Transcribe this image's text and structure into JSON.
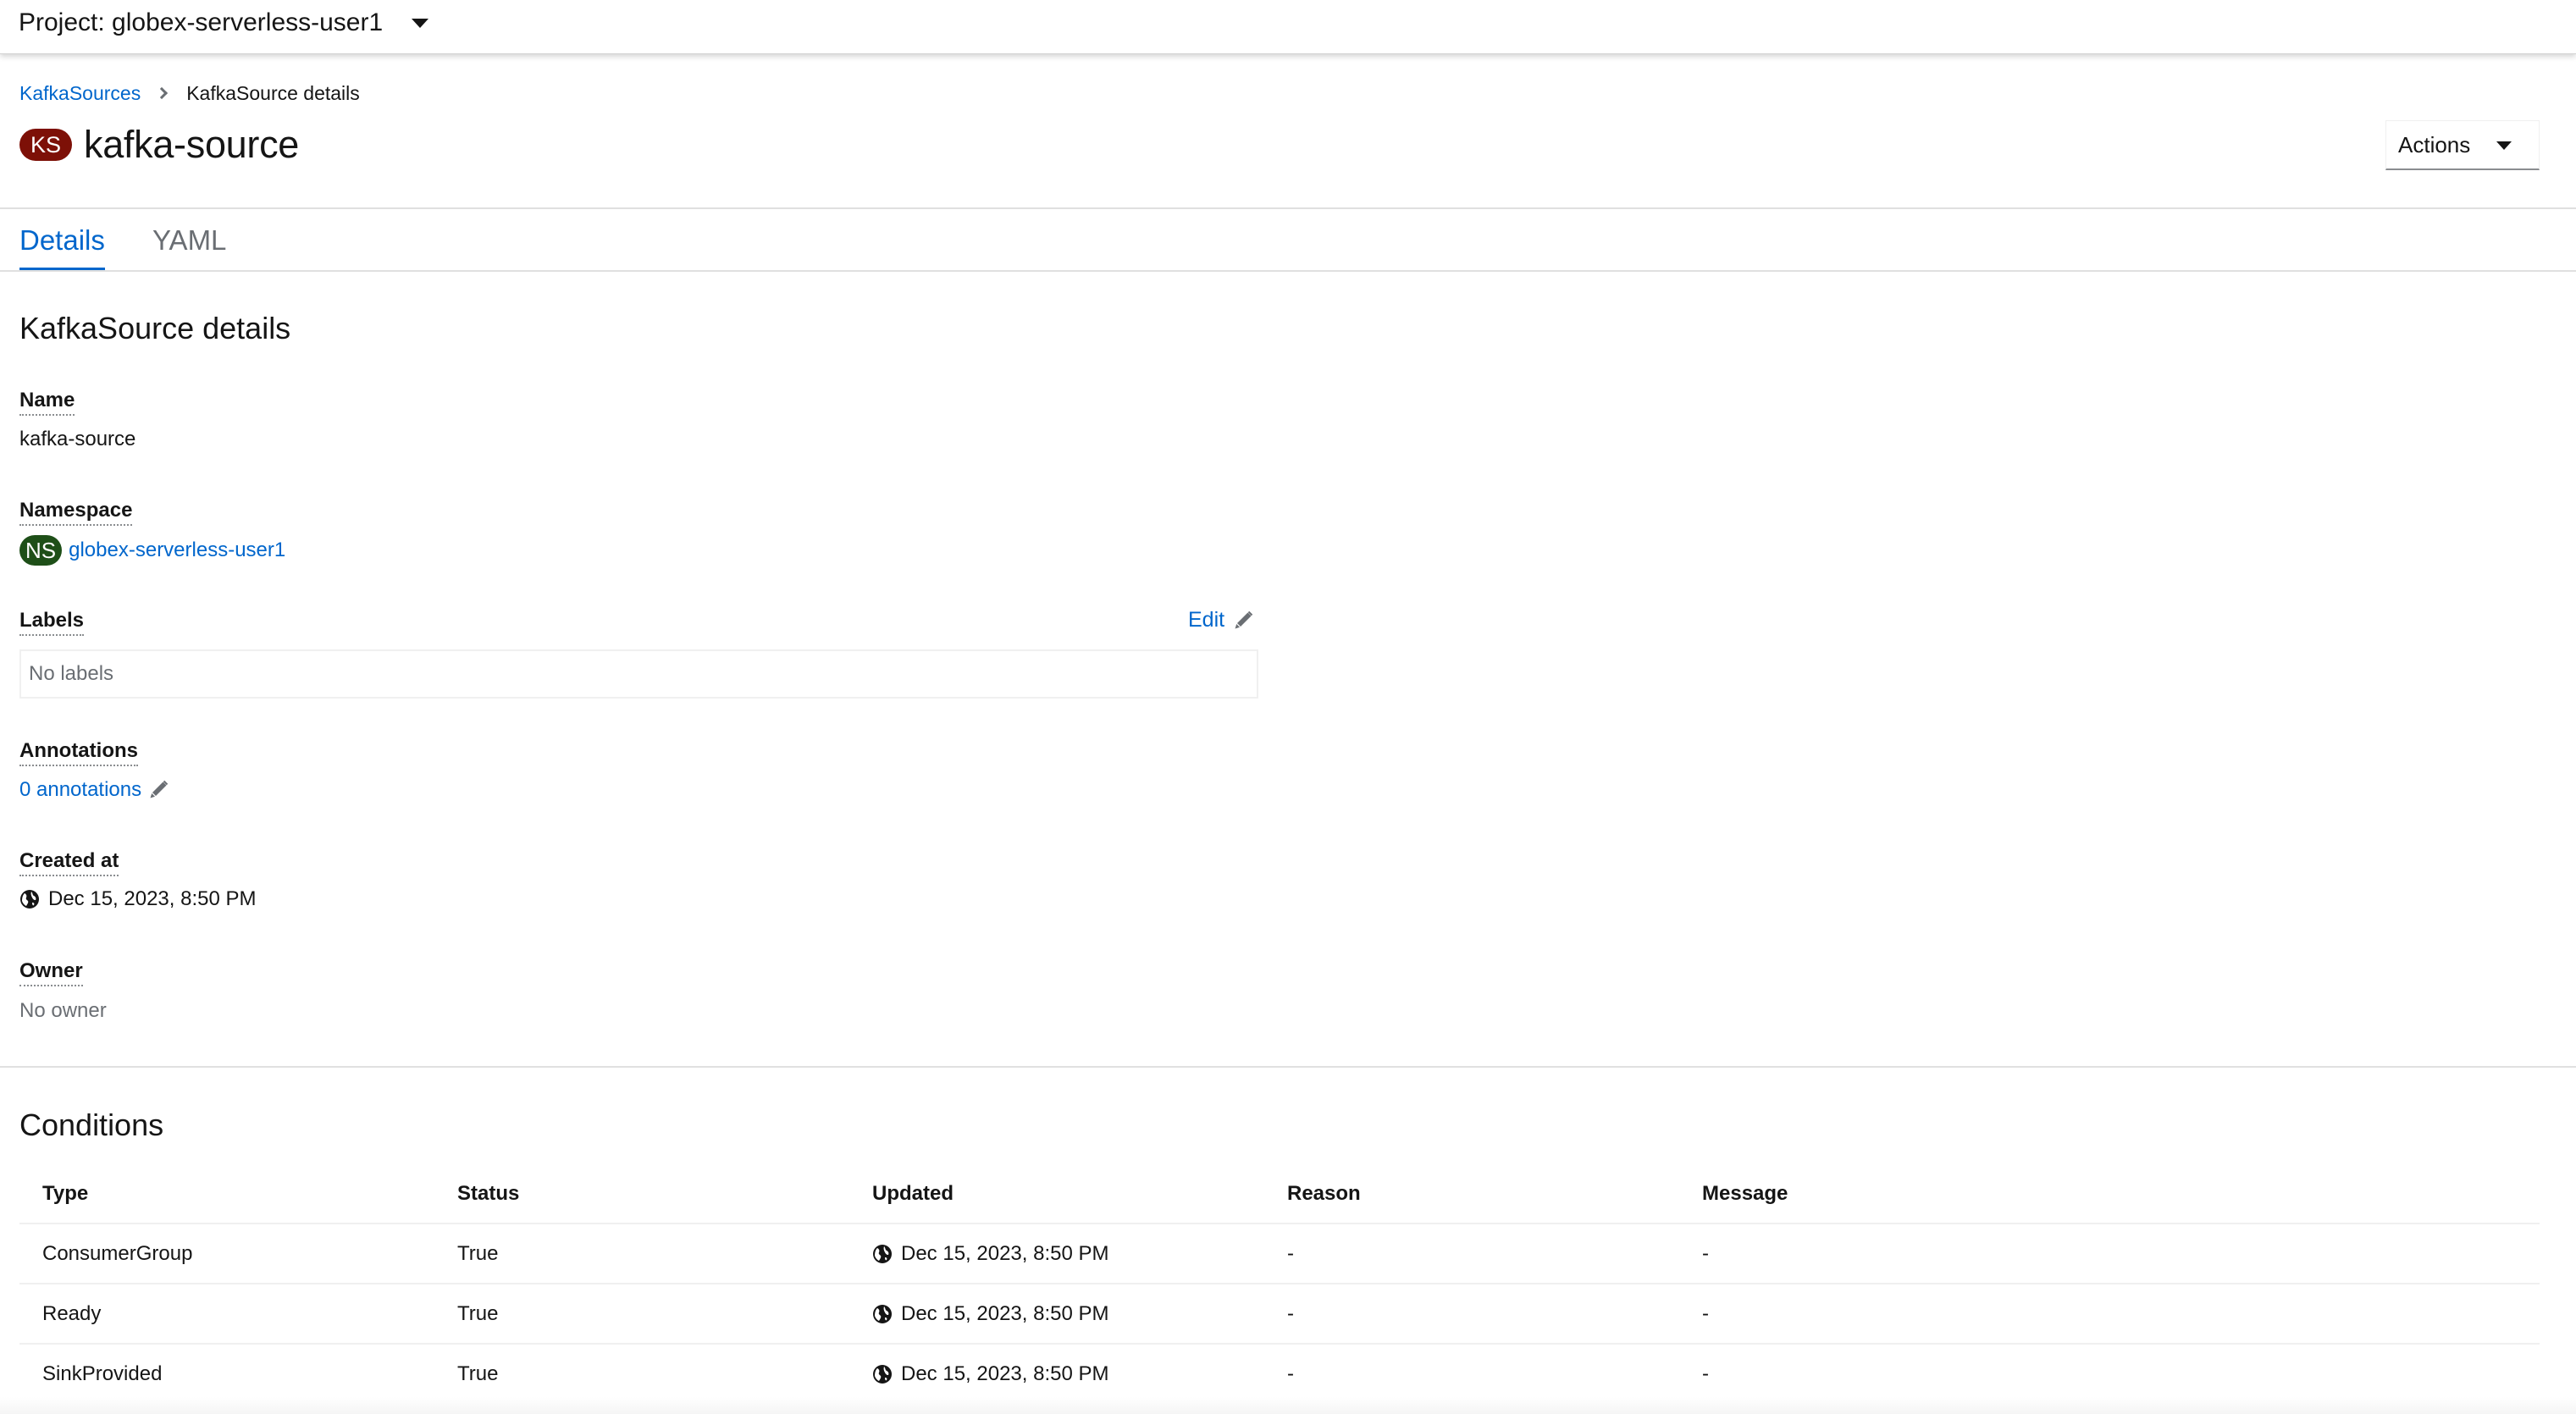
{
  "masthead": {
    "project_label": "Project: globex-serverless-user1"
  },
  "breadcrumb": {
    "parent": "KafkaSources",
    "current": "KafkaSource details"
  },
  "header": {
    "badge_text": "KS",
    "badge_color": "#7d1007",
    "title": "kafka-source",
    "actions_label": "Actions"
  },
  "tabs": [
    {
      "label": "Details",
      "active": true
    },
    {
      "label": "YAML",
      "active": false
    }
  ],
  "details": {
    "heading": "KafkaSource details",
    "name_label": "Name",
    "name_value": "kafka-source",
    "namespace_label": "Namespace",
    "namespace_badge": "NS",
    "namespace_badge_color": "#1e4f18",
    "namespace_value": "globex-serverless-user1",
    "labels_label": "Labels",
    "labels_edit": "Edit",
    "labels_value": "No labels",
    "annotations_label": "Annotations",
    "annotations_value": "0 annotations",
    "created_label": "Created at",
    "created_value": "Dec 15, 2023, 8:50 PM",
    "owner_label": "Owner",
    "owner_value": "No owner"
  },
  "conditions": {
    "heading": "Conditions",
    "columns": [
      "Type",
      "Status",
      "Updated",
      "Reason",
      "Message"
    ],
    "rows": [
      {
        "type": "ConsumerGroup",
        "status": "True",
        "updated": "Dec 15, 2023, 8:50 PM",
        "reason": "-",
        "message": "-"
      },
      {
        "type": "Ready",
        "status": "True",
        "updated": "Dec 15, 2023, 8:50 PM",
        "reason": "-",
        "message": "-"
      },
      {
        "type": "SinkProvided",
        "status": "True",
        "updated": "Dec 15, 2023, 8:50 PM",
        "reason": "-",
        "message": "-"
      }
    ]
  },
  "colors": {
    "link": "#0066cc",
    "text": "#151515",
    "muted": "#6a6e73"
  }
}
